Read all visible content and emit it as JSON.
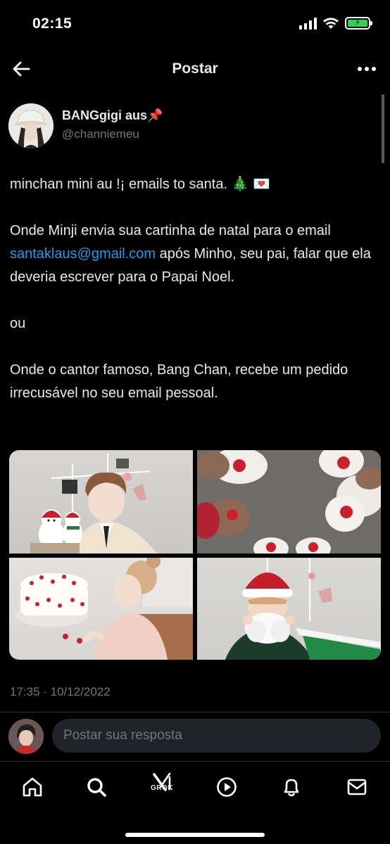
{
  "status_bar": {
    "time": "02:15",
    "battery_color": "#31d158"
  },
  "header": {
    "title": "Postar"
  },
  "author": {
    "name": "BANGgigi aus📌",
    "handle": "@channiemeu"
  },
  "post": {
    "line1": "minchan mini au !¡ emails to santa. 🎄 💌",
    "para2_before": "Onde Minji envia sua cartinha de natal para o email ",
    "para2_link": "santaklaus@gmail.com",
    "para2_after": " após Minho, seu pai, falar que ela deveria escrever para o Papai Noel.",
    "para3": "ou",
    "para4": "Onde o cantor famoso, Bang Chan, recebe um pedido irrecusável no seu email pessoal.",
    "timestamp": "17:35 · 10/12/2022"
  },
  "media": [
    {
      "icon": "photo-boy-with-snowman-dolls"
    },
    {
      "icon": "photo-reindeer-plush"
    },
    {
      "icon": "photo-child-with-cake"
    },
    {
      "icon": "photo-boy-santa-hat"
    }
  ],
  "reply": {
    "placeholder": "Postar sua resposta"
  },
  "nav": {
    "items": [
      {
        "icon": "home-icon"
      },
      {
        "icon": "search-icon"
      },
      {
        "icon": "grok-icon",
        "label": "GROK"
      },
      {
        "icon": "play-icon"
      },
      {
        "icon": "bell-icon"
      },
      {
        "icon": "mail-icon"
      }
    ]
  },
  "colors": {
    "link": "#1d9bf0",
    "secondary_text": "#71767b",
    "background": "#000000"
  }
}
